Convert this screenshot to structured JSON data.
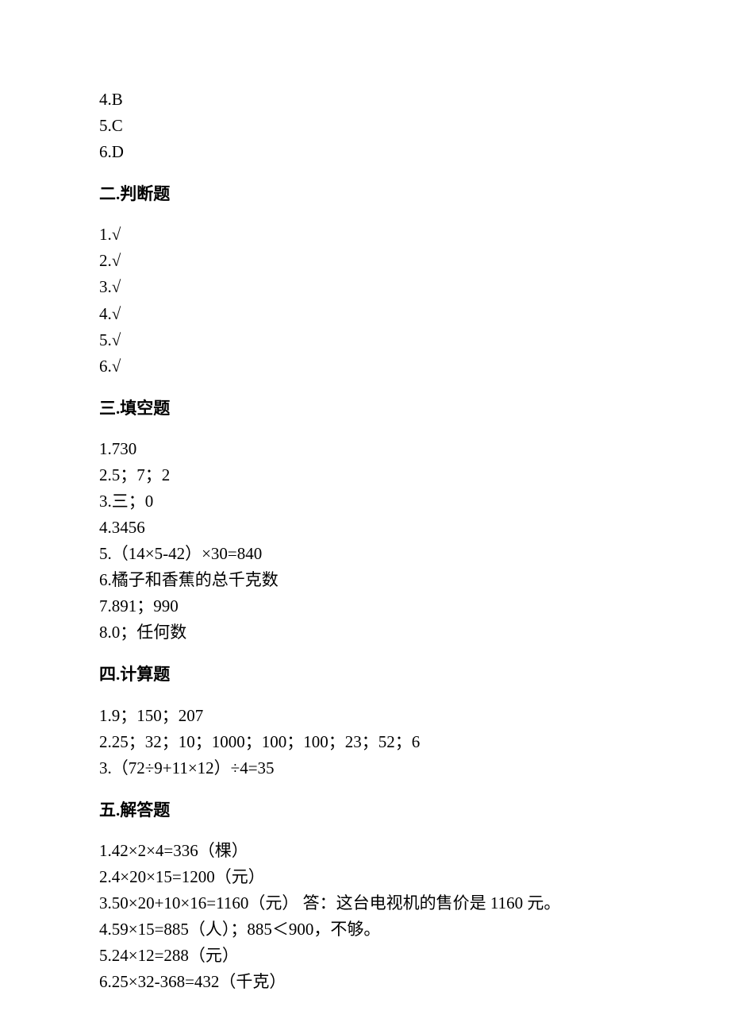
{
  "section1_remaining": [
    "4.B",
    "5.C",
    "6.D"
  ],
  "section2": {
    "heading": "二.判断题",
    "items": [
      "1.√",
      "2.√",
      "3.√",
      "4.√",
      "5.√",
      "6.√"
    ]
  },
  "section3": {
    "heading": "三.填空题",
    "items": [
      "1.730",
      "2.5；7；2",
      "3.三；0",
      "4.3456",
      "5.（14×5-42）×30=840",
      "6.橘子和香蕉的总千克数",
      "7.891；990",
      "8.0；任何数"
    ]
  },
  "section4": {
    "heading": "四.计算题",
    "items": [
      "1.9；150；207",
      "2.25；32；10；1000；100；100；23；52；6",
      "3.（72÷9+11×12）÷4=35"
    ]
  },
  "section5": {
    "heading": "五.解答题",
    "items": [
      "1.42×2×4=336（棵）",
      "2.4×20×15=1200（元）",
      "3.50×20+10×16=1160（元）   答：这台电视机的售价是 1160 元。",
      "4.59×15=885（人）；885＜900，不够。",
      "5.24×12=288（元）",
      "6.25×32-368=432（千克）"
    ]
  }
}
